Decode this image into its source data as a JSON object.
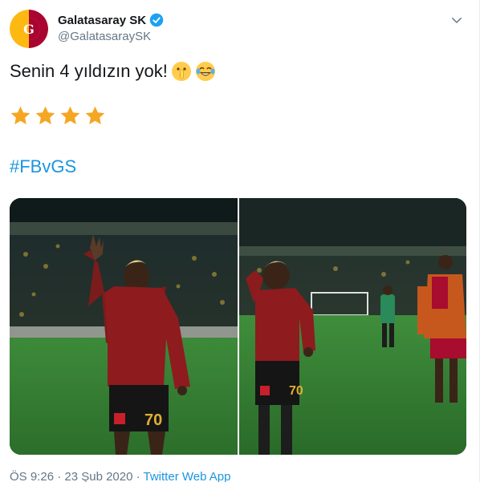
{
  "tweet": {
    "author_name": "Galatasaray SK",
    "author_handle": "@GalatasaraySK",
    "text": "Senin 4 yıldızın yok!",
    "emojis": [
      "shushing-face-icon",
      "tears-of-joy-face-icon"
    ],
    "stars": 4,
    "star_color": "#f5a623",
    "hashtag": "#FBvGS",
    "timestamp": "ÖS 9:26 · 23 Şub 2020 ·",
    "source": "Twitter Web App"
  },
  "colors": {
    "link": "#1b95e0",
    "secondary_text": "#657786",
    "verified": "#1da1f2",
    "club_red": "#a90432",
    "club_yellow": "#fdb912"
  }
}
